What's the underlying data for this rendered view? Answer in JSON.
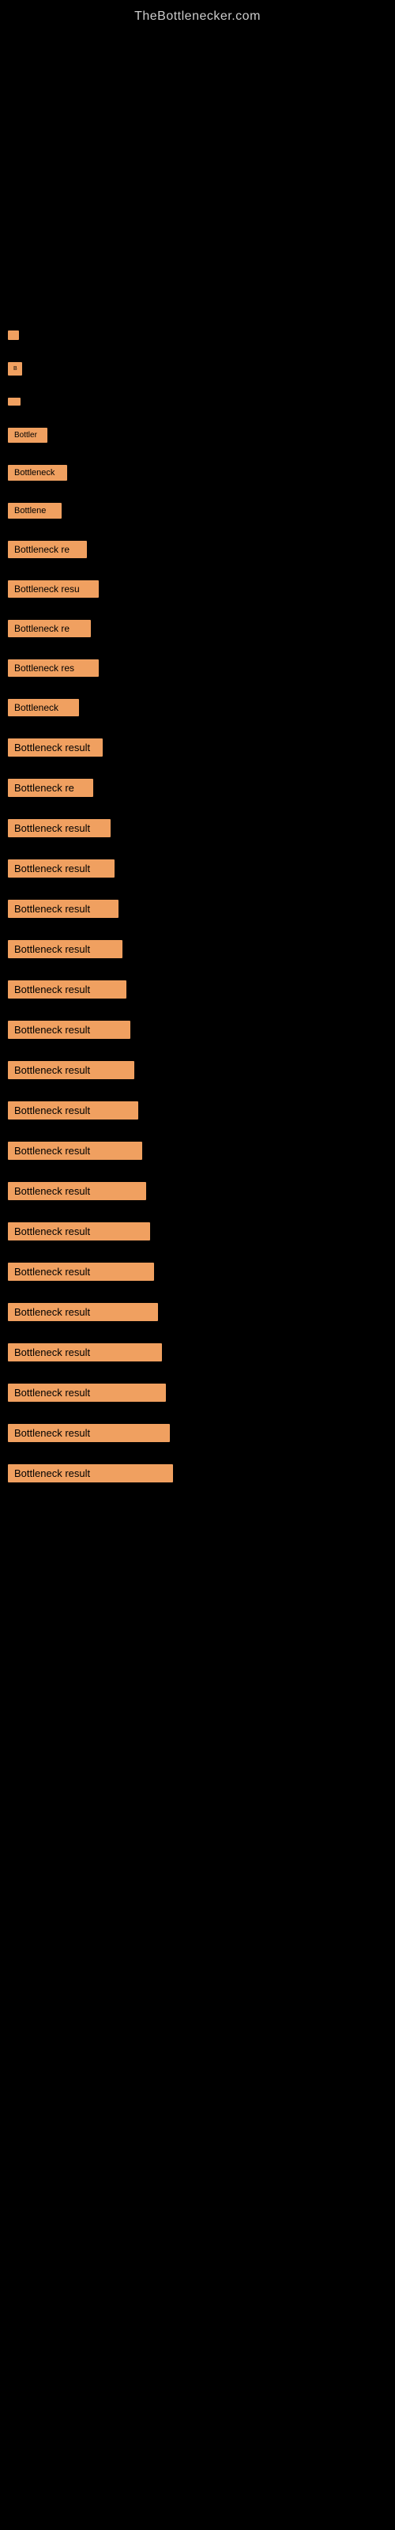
{
  "header": {
    "site_title": "TheBottlenecker.com"
  },
  "results": [
    {
      "id": 1,
      "label": "",
      "class": "item-1"
    },
    {
      "id": 2,
      "label": "B",
      "class": "item-2"
    },
    {
      "id": 3,
      "label": "",
      "class": "item-3"
    },
    {
      "id": 4,
      "label": "Bottler",
      "class": "item-4"
    },
    {
      "id": 5,
      "label": "Bottleneck",
      "class": "item-5"
    },
    {
      "id": 6,
      "label": "Bottlene",
      "class": "item-6"
    },
    {
      "id": 7,
      "label": "Bottleneck re",
      "class": "item-7"
    },
    {
      "id": 8,
      "label": "Bottleneck resu",
      "class": "item-8"
    },
    {
      "id": 9,
      "label": "Bottleneck re",
      "class": "item-9"
    },
    {
      "id": 10,
      "label": "Bottleneck res",
      "class": "item-10"
    },
    {
      "id": 11,
      "label": "Bottleneck",
      "class": "item-11"
    },
    {
      "id": 12,
      "label": "Bottleneck result",
      "class": "item-12"
    },
    {
      "id": 13,
      "label": "Bottleneck re",
      "class": "item-13"
    },
    {
      "id": 14,
      "label": "Bottleneck result",
      "class": "item-14"
    },
    {
      "id": 15,
      "label": "Bottleneck result",
      "class": "item-15"
    },
    {
      "id": 16,
      "label": "Bottleneck result",
      "class": "item-16"
    },
    {
      "id": 17,
      "label": "Bottleneck result",
      "class": "item-17"
    },
    {
      "id": 18,
      "label": "Bottleneck result",
      "class": "item-18"
    },
    {
      "id": 19,
      "label": "Bottleneck result",
      "class": "item-19"
    },
    {
      "id": 20,
      "label": "Bottleneck result",
      "class": "item-20"
    },
    {
      "id": 21,
      "label": "Bottleneck result",
      "class": "item-21"
    },
    {
      "id": 22,
      "label": "Bottleneck result",
      "class": "item-22"
    },
    {
      "id": 23,
      "label": "Bottleneck result",
      "class": "item-23"
    },
    {
      "id": 24,
      "label": "Bottleneck result",
      "class": "item-24"
    },
    {
      "id": 25,
      "label": "Bottleneck result",
      "class": "item-25"
    },
    {
      "id": 26,
      "label": "Bottleneck result",
      "class": "item-26"
    },
    {
      "id": 27,
      "label": "Bottleneck result",
      "class": "item-27"
    },
    {
      "id": 28,
      "label": "Bottleneck result",
      "class": "item-28"
    },
    {
      "id": 29,
      "label": "Bottleneck result",
      "class": "item-29"
    },
    {
      "id": 30,
      "label": "Bottleneck result",
      "class": "item-30"
    }
  ]
}
